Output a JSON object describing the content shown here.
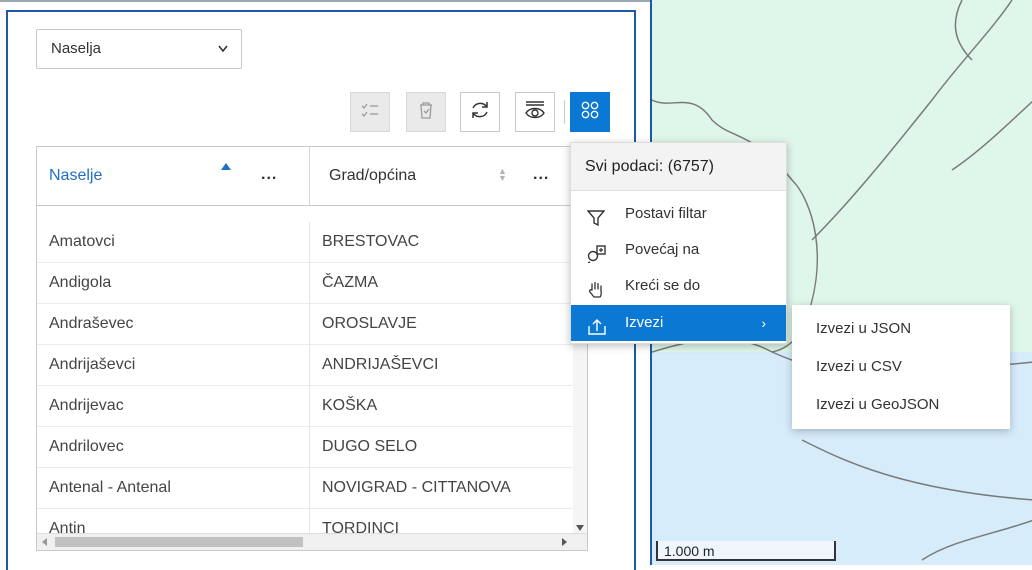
{
  "layer_select": {
    "value": "Naselja",
    "chevron": "chevron-down-icon"
  },
  "toolbar": {
    "buttons": [
      {
        "icon": "show-selection-icon",
        "state": "disabled"
      },
      {
        "icon": "delete-selection-icon",
        "state": "disabled"
      },
      {
        "icon": "refresh-icon",
        "state": "enabled"
      },
      {
        "icon": "visibility-filter-icon",
        "state": "enabled"
      },
      {
        "icon": "options-grid-icon",
        "state": "active"
      }
    ]
  },
  "table": {
    "headers": [
      "Naselje",
      "Grad/općina"
    ],
    "menu_dots": "...",
    "rows": [
      [
        "Amatovci",
        "BRESTOVAC"
      ],
      [
        "Andigola",
        "ČAZMA"
      ],
      [
        "Andraševec",
        "OROSLAVJE"
      ],
      [
        "Andrijaševci",
        "ANDRIJAŠEVCI"
      ],
      [
        "Andrijevac",
        "KOŠKA"
      ],
      [
        "Andrilovec",
        "DUGO SELO"
      ],
      [
        "Antenal - Antenal",
        "NOVIGRAD - CITTANOVA"
      ],
      [
        "Antin",
        "TORDINCI"
      ]
    ]
  },
  "menu": {
    "title": "Svi podaci: (6757)",
    "items": [
      {
        "label": "Postavi filtar",
        "icon": "filter-icon"
      },
      {
        "label": "Povećaj na",
        "icon": "zoom-to-icon"
      },
      {
        "label": "Kreći se do",
        "icon": "pan-hand-icon"
      },
      {
        "label": "Izvezi",
        "icon": "export-icon",
        "arrow": "›"
      }
    ]
  },
  "submenu": {
    "items": [
      "Izvezi u JSON",
      "Izvezi u CSV",
      "Izvezi u GeoJSON"
    ]
  },
  "map": {
    "scale_label": "1.000 m"
  },
  "colors": {
    "accent": "#0b78d4",
    "map_land": "#dff7ea",
    "map_water": "#d6ecfb"
  }
}
